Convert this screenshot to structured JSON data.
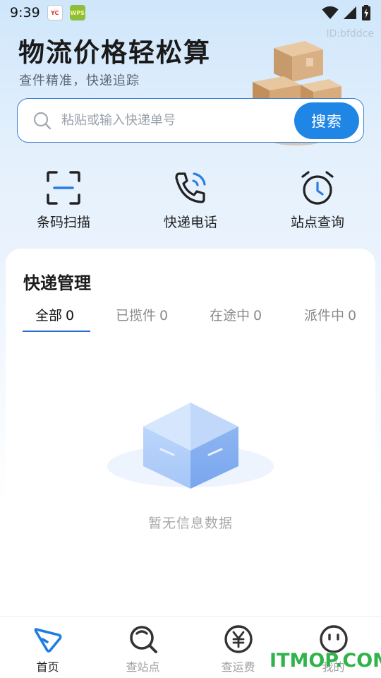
{
  "status_bar": {
    "time": "9:39",
    "app_icons": [
      "yc-app-icon",
      "wps-app-icon"
    ],
    "app_icon_labels": [
      "YC",
      "WPS"
    ]
  },
  "hero": {
    "id_label": "ID:bfddce",
    "title": "物流价格轻松算",
    "subtitle": "查件精准，快递追踪"
  },
  "search": {
    "placeholder": "粘贴或输入快递单号",
    "value": "",
    "button_label": "搜索"
  },
  "actions": [
    {
      "label": "条码扫描",
      "icon": "barcode-scan-icon"
    },
    {
      "label": "快递电话",
      "icon": "phone-call-icon"
    },
    {
      "label": "站点查询",
      "icon": "alarm-clock-icon"
    }
  ],
  "management": {
    "title": "快递管理",
    "tabs": [
      {
        "label": "全部",
        "count": "0",
        "active": true
      },
      {
        "label": "已揽件",
        "count": "0",
        "active": false
      },
      {
        "label": "在途中",
        "count": "0",
        "active": false
      },
      {
        "label": "派件中",
        "count": "0",
        "active": false
      }
    ],
    "empty_text": "暂无信息数据"
  },
  "bottom_nav": [
    {
      "label": "首页",
      "icon": "home-icon",
      "active": true
    },
    {
      "label": "查站点",
      "icon": "search-station-icon",
      "active": false
    },
    {
      "label": "查运费",
      "icon": "yen-icon",
      "active": false
    },
    {
      "label": "我的",
      "icon": "profile-face-icon",
      "active": false
    }
  ],
  "watermark": "ITMOP.COM",
  "colors": {
    "accent": "#1f86e6",
    "search_border": "#3a82d8",
    "tab_underline": "#2a6cc7",
    "watermark": "#2fb34a"
  }
}
